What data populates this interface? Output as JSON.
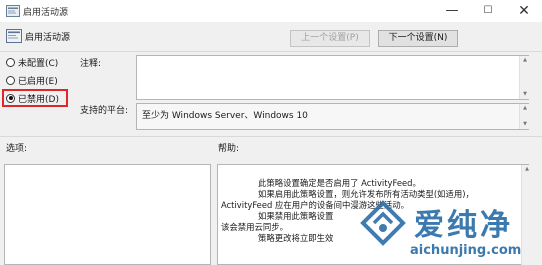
{
  "window": {
    "title": "启用活动源",
    "minimize_glyph": "—",
    "maximize_glyph": "☐",
    "close_glyph": "✕"
  },
  "policy": {
    "name": "启用活动源"
  },
  "nav": {
    "prev_label": "上一个设置(P)",
    "next_label": "下一个设置(N)"
  },
  "state": {
    "options": [
      {
        "label": "未配置(C)",
        "selected": false
      },
      {
        "label": "已启用(E)",
        "selected": false
      },
      {
        "label": "已禁用(D)",
        "selected": true
      }
    ]
  },
  "comment": {
    "label": "注释:",
    "value": ""
  },
  "platform": {
    "label": "支持的平台:",
    "value": "至少为 Windows Server、Windows 10"
  },
  "options_section": {
    "label": "选项:"
  },
  "help_section": {
    "label": "帮助:",
    "lines": [
      "此策略设置确定是否启用了 ActivityFeed。",
      "如果启用此策略设置，则允许发布所有活动类型(如适用)，",
      "ActivityFeed 应在用户的设备间中漫游这些活动。",
      "如果禁用此策略设置",
      "该会禁用云同步。",
      "策略更改将立即生效"
    ]
  },
  "watermark": {
    "brand": "爱纯净",
    "url": "aichunjing.com"
  },
  "colors": {
    "highlight": "#e0252b",
    "watermark": "#2b6ea8"
  }
}
